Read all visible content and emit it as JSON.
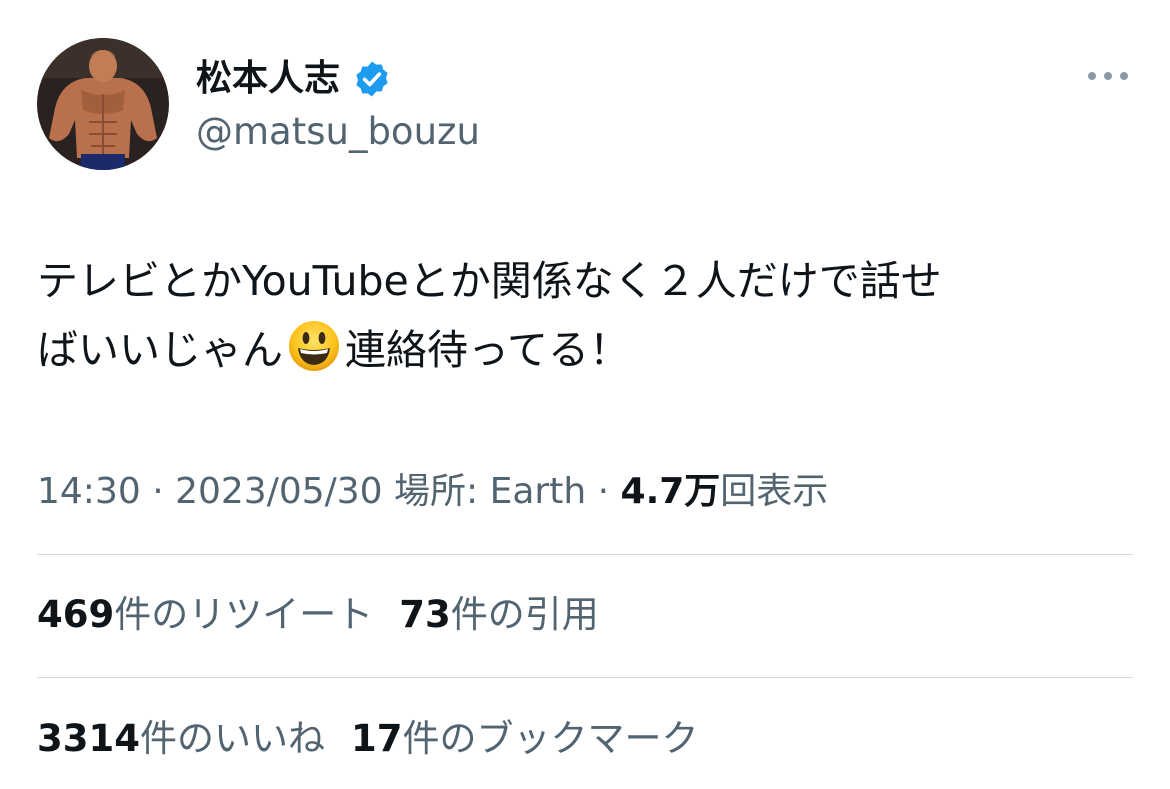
{
  "user": {
    "display_name": "松本人志",
    "handle": "@matsu_bouzu",
    "verified": true,
    "avatar_icon": "bodybuilder-figure-avatar",
    "verified_icon": "verified-badge-icon",
    "verified_color": "#1d9bf0"
  },
  "more_icon": "more-options-icon",
  "tweet": {
    "line1": "テレビとかYouTubeとか関係なく２人だけで話せ",
    "line2_before_emoji": "ばいいじゃん",
    "emoji": "grinning-face-emoji",
    "line2_after_emoji": "連絡待ってる！"
  },
  "meta": {
    "time": "14:30",
    "separator": " · ",
    "date": "2023/05/30",
    "location_label": "場所: Earth",
    "views_count": "4.7万",
    "views_label": "回表示"
  },
  "stats": {
    "retweets_count": "469",
    "retweets_label": "件のリツイート",
    "quotes_count": "73",
    "quotes_label": "件の引用",
    "likes_count": "3314",
    "likes_label": "件のいいね",
    "bookmarks_count": "17",
    "bookmarks_label": "件のブックマーク"
  },
  "colors": {
    "text_primary": "#0f1419",
    "text_secondary": "#536471",
    "divider": "#cfd9de"
  }
}
